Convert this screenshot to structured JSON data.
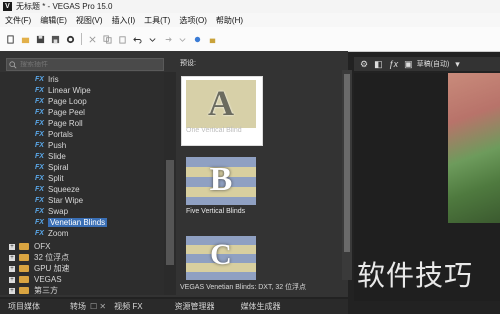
{
  "window": {
    "title": "无标题 * - VEGAS Pro 15.0",
    "app_icon": "V"
  },
  "menu": [
    "文件(F)",
    "编辑(E)",
    "视图(V)",
    "插入(I)",
    "工具(T)",
    "选项(O)",
    "帮助(H)"
  ],
  "search": {
    "placeholder": "搜索插件"
  },
  "tree": {
    "fx_items": [
      "Iris",
      "Linear Wipe",
      "Page Loop",
      "Page Peel",
      "Page Roll",
      "Portals",
      "Push",
      "Slide",
      "Spiral",
      "Split",
      "Squeeze",
      "Star Wipe",
      "Swap",
      "Venetian Blinds",
      "Zoom"
    ],
    "fx_badge": "FX",
    "selected": "Venetian Blinds",
    "folders": [
      "OFX",
      "32 位浮点",
      "GPU 加速",
      "VEGAS",
      "第三方"
    ]
  },
  "presets": {
    "header": "预设:",
    "items": [
      {
        "label": "One Vertical Blind",
        "letter": "A"
      },
      {
        "label": "Five Vertical Blinds",
        "letter": "B"
      },
      {
        "label": "",
        "letter": "C"
      }
    ],
    "status": "VEGAS Venetian Blinds: DXT, 32 位浮点"
  },
  "bottom_tabs": [
    "项目媒体",
    "转场",
    "视频 FX",
    "资源管理器",
    "媒体生成器"
  ],
  "preview": {
    "quality": "草稿(自动)"
  },
  "watermark": "软件技巧",
  "colors": {
    "fx_badge": "#5aa7e8",
    "selection": "#3a6fb5",
    "thumb_bg": "#d3cfa6"
  }
}
